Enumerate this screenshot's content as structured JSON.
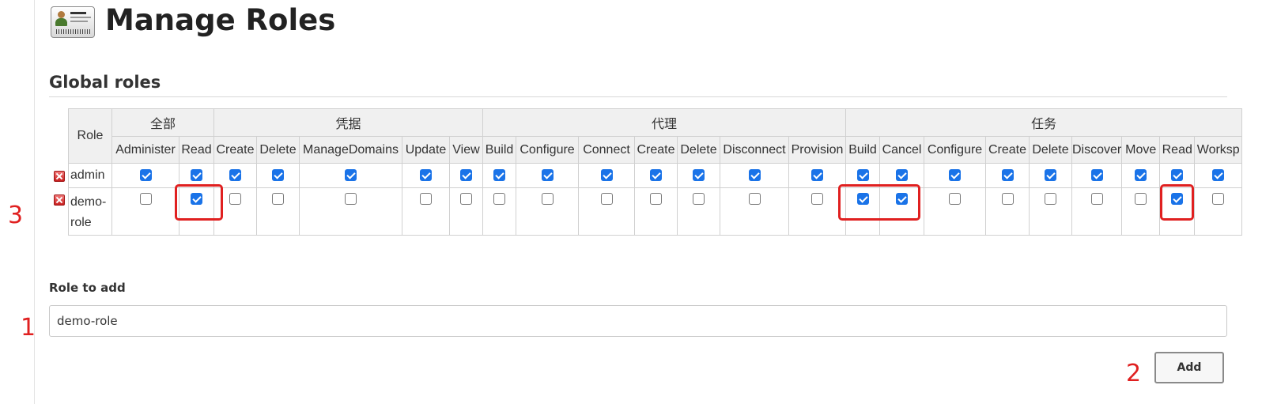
{
  "page": {
    "title": "Manage Roles",
    "icon": "id-card-icon"
  },
  "section": {
    "title": "Global roles"
  },
  "table": {
    "role_header": "Role",
    "groups": [
      "全部",
      "凭据",
      "代理",
      "任务"
    ],
    "permissions": [
      "Administer",
      "Read",
      "Create",
      "Delete",
      "ManageDomains",
      "Update",
      "View",
      "Build",
      "Configure",
      "Connect",
      "Create",
      "Delete",
      "Disconnect",
      "Provision",
      "Build",
      "Cancel",
      "Configure",
      "Create",
      "Delete",
      "Discover",
      "Move",
      "Read",
      "Worksp"
    ],
    "rows": [
      {
        "name": "admin",
        "checks": [
          true,
          true,
          true,
          true,
          true,
          true,
          true,
          true,
          true,
          true,
          true,
          true,
          true,
          true,
          true,
          true,
          true,
          true,
          true,
          true,
          true,
          true,
          true
        ]
      },
      {
        "name": "demo-role",
        "checks": [
          false,
          true,
          false,
          false,
          false,
          false,
          false,
          false,
          false,
          false,
          false,
          false,
          false,
          false,
          true,
          true,
          false,
          false,
          false,
          false,
          false,
          true,
          false
        ]
      }
    ]
  },
  "annotations": {
    "step1": "1",
    "step2": "2",
    "step3": "3"
  },
  "form": {
    "label": "Role to add",
    "value": "demo-role",
    "button": "Add"
  },
  "colors": {
    "accent": "#1a73e8",
    "highlight": "#e02020"
  }
}
